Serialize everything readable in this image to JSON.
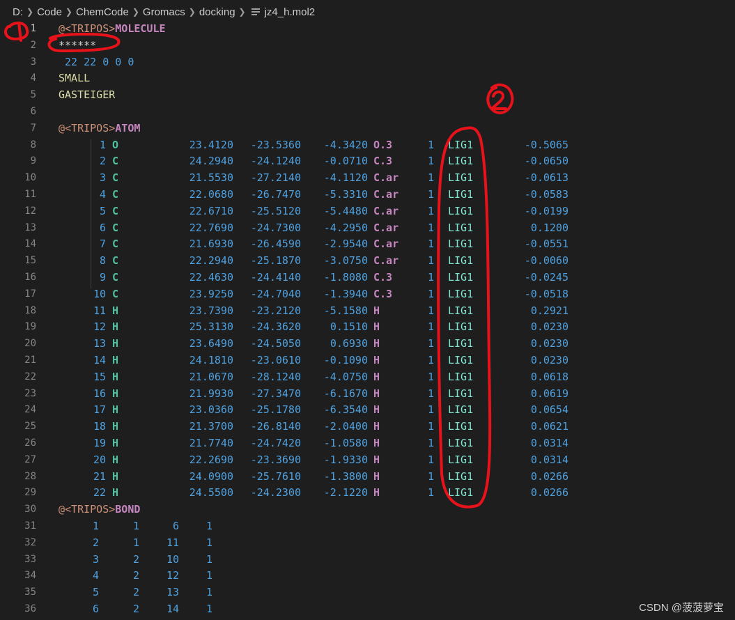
{
  "breadcrumb": {
    "items": [
      "D:",
      "Code",
      "ChemCode",
      "Gromacs",
      "docking"
    ],
    "file": "jz4_h.mol2"
  },
  "editor": {
    "active_line": 1,
    "header": [
      {
        "n": "1",
        "kind": "section",
        "at": "@",
        "tag": "<TRIPOS>",
        "name": "MOLECULE"
      },
      {
        "n": "2",
        "kind": "plain",
        "text": "******"
      },
      {
        "n": "3",
        "kind": "nums",
        "text": " 22 22 0 0 0"
      },
      {
        "n": "4",
        "kind": "yellow",
        "text": "SMALL"
      },
      {
        "n": "5",
        "kind": "yellow",
        "text": "GASTEIGER"
      },
      {
        "n": "6",
        "kind": "plain",
        "text": ""
      },
      {
        "n": "7",
        "kind": "section",
        "at": "@",
        "tag": "<TRIPOS>",
        "name": "ATOM"
      }
    ],
    "atoms": [
      {
        "n": "8",
        "id": "1",
        "el": "O",
        "x": "23.4120",
        "y": "-23.5360",
        "z": "-4.3420",
        "type": "O.3",
        "sub": "1",
        "res": "LIG1",
        "q": "-0.5065"
      },
      {
        "n": "9",
        "id": "2",
        "el": "C",
        "x": "24.2940",
        "y": "-24.1240",
        "z": "-0.0710",
        "type": "C.3",
        "sub": "1",
        "res": "LIG1",
        "q": "-0.0650"
      },
      {
        "n": "10",
        "id": "3",
        "el": "C",
        "x": "21.5530",
        "y": "-27.2140",
        "z": "-4.1120",
        "type": "C.ar",
        "sub": "1",
        "res": "LIG1",
        "q": "-0.0613"
      },
      {
        "n": "11",
        "id": "4",
        "el": "C",
        "x": "22.0680",
        "y": "-26.7470",
        "z": "-5.3310",
        "type": "C.ar",
        "sub": "1",
        "res": "LIG1",
        "q": "-0.0583"
      },
      {
        "n": "12",
        "id": "5",
        "el": "C",
        "x": "22.6710",
        "y": "-25.5120",
        "z": "-5.4480",
        "type": "C.ar",
        "sub": "1",
        "res": "LIG1",
        "q": "-0.0199"
      },
      {
        "n": "13",
        "id": "6",
        "el": "C",
        "x": "22.7690",
        "y": "-24.7300",
        "z": "-4.2950",
        "type": "C.ar",
        "sub": "1",
        "res": "LIG1",
        "q": "0.1200"
      },
      {
        "n": "14",
        "id": "7",
        "el": "C",
        "x": "21.6930",
        "y": "-26.4590",
        "z": "-2.9540",
        "type": "C.ar",
        "sub": "1",
        "res": "LIG1",
        "q": "-0.0551"
      },
      {
        "n": "15",
        "id": "8",
        "el": "C",
        "x": "22.2940",
        "y": "-25.1870",
        "z": "-3.0750",
        "type": "C.ar",
        "sub": "1",
        "res": "LIG1",
        "q": "-0.0060"
      },
      {
        "n": "16",
        "id": "9",
        "el": "C",
        "x": "22.4630",
        "y": "-24.4140",
        "z": "-1.8080",
        "type": "C.3",
        "sub": "1",
        "res": "LIG1",
        "q": "-0.0245"
      },
      {
        "n": "17",
        "id": "10",
        "el": "C",
        "x": "23.9250",
        "y": "-24.7040",
        "z": "-1.3940",
        "type": "C.3",
        "sub": "1",
        "res": "LIG1",
        "q": "-0.0518"
      },
      {
        "n": "18",
        "id": "11",
        "el": "H",
        "x": "23.7390",
        "y": "-23.2120",
        "z": "-5.1580",
        "type": "H",
        "sub": "1",
        "res": "LIG1",
        "q": "0.2921"
      },
      {
        "n": "19",
        "id": "12",
        "el": "H",
        "x": "25.3130",
        "y": "-24.3620",
        "z": "0.1510",
        "type": "H",
        "sub": "1",
        "res": "LIG1",
        "q": "0.0230"
      },
      {
        "n": "20",
        "id": "13",
        "el": "H",
        "x": "23.6490",
        "y": "-24.5050",
        "z": "0.6930",
        "type": "H",
        "sub": "1",
        "res": "LIG1",
        "q": "0.0230"
      },
      {
        "n": "21",
        "id": "14",
        "el": "H",
        "x": "24.1810",
        "y": "-23.0610",
        "z": "-0.1090",
        "type": "H",
        "sub": "1",
        "res": "LIG1",
        "q": "0.0230"
      },
      {
        "n": "22",
        "id": "15",
        "el": "H",
        "x": "21.0670",
        "y": "-28.1240",
        "z": "-4.0750",
        "type": "H",
        "sub": "1",
        "res": "LIG1",
        "q": "0.0618"
      },
      {
        "n": "23",
        "id": "16",
        "el": "H",
        "x": "21.9930",
        "y": "-27.3470",
        "z": "-6.1670",
        "type": "H",
        "sub": "1",
        "res": "LIG1",
        "q": "0.0619"
      },
      {
        "n": "24",
        "id": "17",
        "el": "H",
        "x": "23.0360",
        "y": "-25.1780",
        "z": "-6.3540",
        "type": "H",
        "sub": "1",
        "res": "LIG1",
        "q": "0.0654"
      },
      {
        "n": "25",
        "id": "18",
        "el": "H",
        "x": "21.3700",
        "y": "-26.8140",
        "z": "-2.0400",
        "type": "H",
        "sub": "1",
        "res": "LIG1",
        "q": "0.0621"
      },
      {
        "n": "26",
        "id": "19",
        "el": "H",
        "x": "21.7740",
        "y": "-24.7420",
        "z": "-1.0580",
        "type": "H",
        "sub": "1",
        "res": "LIG1",
        "q": "0.0314"
      },
      {
        "n": "27",
        "id": "20",
        "el": "H",
        "x": "22.2690",
        "y": "-23.3690",
        "z": "-1.9330",
        "type": "H",
        "sub": "1",
        "res": "LIG1",
        "q": "0.0314"
      },
      {
        "n": "28",
        "id": "21",
        "el": "H",
        "x": "24.0900",
        "y": "-25.7610",
        "z": "-1.3800",
        "type": "H",
        "sub": "1",
        "res": "LIG1",
        "q": "0.0266"
      },
      {
        "n": "29",
        "id": "22",
        "el": "H",
        "x": "24.5500",
        "y": "-24.2300",
        "z": "-2.1220",
        "type": "H",
        "sub": "1",
        "res": "LIG1",
        "q": "0.0266"
      }
    ],
    "bond_header": {
      "n": "30",
      "at": "@",
      "tag": "<TRIPOS>",
      "name": "BOND"
    },
    "bonds": [
      {
        "n": "31",
        "id": "1",
        "a": "1",
        "b": "6",
        "t": "1"
      },
      {
        "n": "32",
        "id": "2",
        "a": "1",
        "b": "11",
        "t": "1"
      },
      {
        "n": "33",
        "id": "3",
        "a": "2",
        "b": "10",
        "t": "1"
      },
      {
        "n": "34",
        "id": "4",
        "a": "2",
        "b": "12",
        "t": "1"
      },
      {
        "n": "35",
        "id": "5",
        "a": "2",
        "b": "13",
        "t": "1"
      },
      {
        "n": "36",
        "id": "6",
        "a": "2",
        "b": "14",
        "t": "1"
      }
    ]
  },
  "annotations": {
    "label_1": "1",
    "label_2": "2",
    "color": "#e8121b"
  },
  "watermark": "CSDN @菠菠萝宝",
  "colors": {
    "background": "#1e1e1e",
    "number": "#4fa1e0",
    "section": "#c586c0",
    "element": "#4fc1a0",
    "residue": "#7fe5d0",
    "string": "#dcdcaa"
  }
}
